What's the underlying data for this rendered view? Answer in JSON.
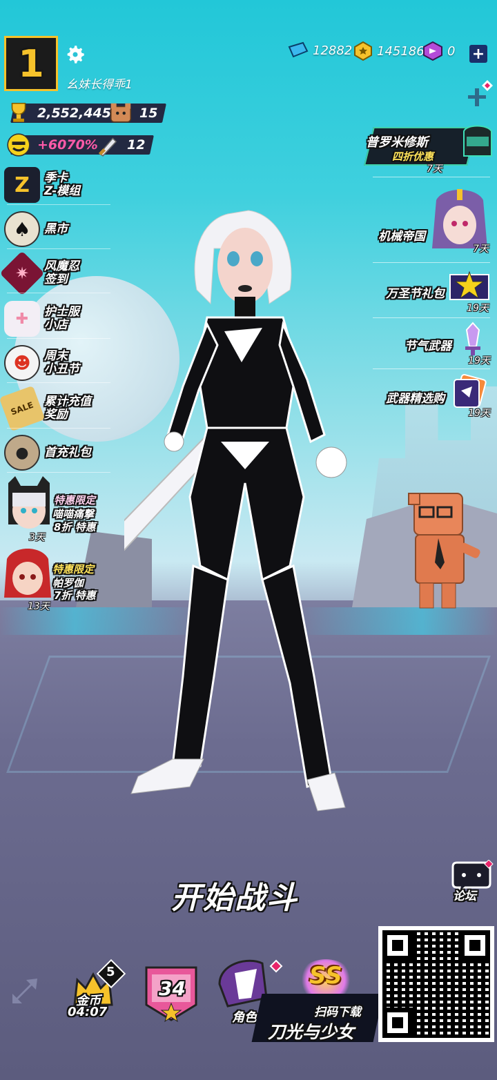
{
  "player": {
    "level": "1",
    "name": "幺妹长得乖1"
  },
  "stats": {
    "trophies": "2,552,445",
    "bears": "15",
    "bonus": "+6070%",
    "swords": "12"
  },
  "currency": {
    "gems": "12882",
    "coins": "145186",
    "crystals": "0",
    "add": "+"
  },
  "left_menu": [
    {
      "label": "季卡\nZ-模组",
      "line1": "季卡",
      "line2": "Z-模组"
    },
    {
      "label": "黑市",
      "line1": "黑市",
      "line2": ""
    },
    {
      "label": "风魔忍\n签到",
      "line1": "风魔忍",
      "line2": "签到"
    },
    {
      "label": "护士服\n小店",
      "line1": "护士服",
      "line2": "小店"
    },
    {
      "label": "周末\n小丑节",
      "line1": "周末",
      "line2": "小丑节"
    },
    {
      "label": "累计充值\n奖励",
      "line1": "累计充值",
      "line2": "奖励"
    },
    {
      "label": "首充礼包",
      "line1": "首充礼包",
      "line2": ""
    }
  ],
  "left_offers": [
    {
      "tag": "特惠限定",
      "name": "喵喵痛撃",
      "discount": "8折 特惠",
      "days": "3天"
    },
    {
      "tag": "特惠限定",
      "name": "帕罗伽",
      "discount": "7折 特惠",
      "days": "13天"
    }
  ],
  "right_menu": [
    {
      "label": "普罗米修斯",
      "sub": "四折优惠",
      "days": "7天"
    },
    {
      "label": "机械帝国",
      "days": "7天"
    },
    {
      "label": "万圣节礼包",
      "days": "19天"
    },
    {
      "label": "节气武器",
      "days": "19天"
    },
    {
      "label": "武器精选购",
      "days": "19天"
    }
  ],
  "forum": {
    "label": "论坛"
  },
  "start_battle": "开始战斗",
  "bottom_bar": {
    "gold": {
      "label": "金币",
      "timer": "04:07",
      "badge": "5"
    },
    "rank": {
      "value": "34"
    },
    "role": {
      "label": "角色"
    },
    "ss_label": "SS"
  },
  "promo": {
    "scan": "扫码下载",
    "title": "刀光与少女"
  },
  "colors": {
    "accent_yellow": "#f6c22b",
    "dark_panel": "#232942",
    "sky": "#22c7d8"
  }
}
